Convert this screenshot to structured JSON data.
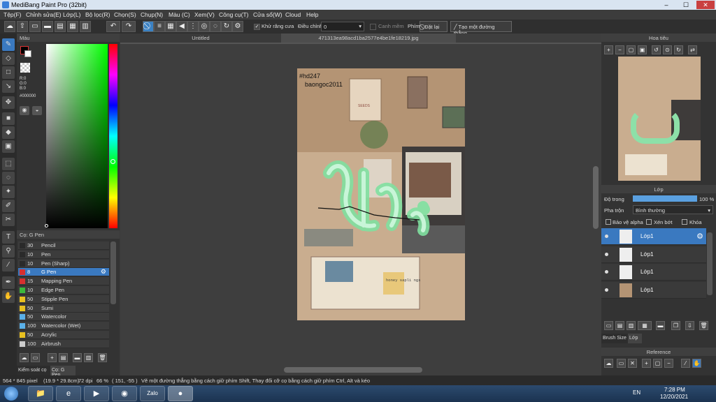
{
  "window": {
    "title": "MediBang Paint Pro (32bit)",
    "min": "–",
    "max": "☐",
    "close": "✕"
  },
  "menu": [
    "Tệp(F)",
    "Chỉnh sửa(E)",
    "Lớp(L)",
    "Bộ lọc(R)",
    "Chọn(S)",
    "Chụp(N)",
    "Màu (C)",
    "Xem(V)",
    "Công cụ(T)",
    "Cửa sổ(W)",
    "Cloud",
    "Help"
  ],
  "toolbar": {
    "antialias_label": "Khử răng cưa",
    "adjust_label": "Điều chỉnh",
    "adjust_value": "0",
    "snap_label": "Canh mềm",
    "key_label": "Phím",
    "reset_label": "Đặt lại",
    "straight_label": "Tạo một đường thẳng"
  },
  "color_panel": {
    "title": "Màu",
    "r": "R:0",
    "g": "G:0",
    "b": "B:0",
    "hex": "#000000"
  },
  "brush_panel": {
    "title": "Cọ: G Pen",
    "brushes": [
      {
        "size": "30",
        "name": "Pencil",
        "color": "#2a2a2a"
      },
      {
        "size": "10",
        "name": "Pen",
        "color": "#2a2a2a"
      },
      {
        "size": "10",
        "name": "Pen (Sharp)",
        "color": "#2a2a2a"
      },
      {
        "size": "8",
        "name": "G Pen",
        "color": "#d83030",
        "selected": true
      },
      {
        "size": "15",
        "name": "Mapping Pen",
        "color": "#d83030"
      },
      {
        "size": "10",
        "name": "Edge Pen",
        "color": "#3cb83c"
      },
      {
        "size": "50",
        "name": "Stipple Pen",
        "color": "#e8c020"
      },
      {
        "size": "50",
        "name": "Sumi",
        "color": "#e8c020"
      },
      {
        "size": "50",
        "name": "Watercolor",
        "color": "#5ab0e8"
      },
      {
        "size": "100",
        "name": "Watercolor (Wet)",
        "color": "#5ab0e8"
      },
      {
        "size": "50",
        "name": "Acrylic",
        "color": "#e8c020"
      },
      {
        "size": "100",
        "name": "Airbrush",
        "color": "#cccccc"
      }
    ],
    "tab1": "Kiểm soát cọ",
    "tab2": "Cọ: G Pen"
  },
  "canvas": {
    "tab_untitled": "Untitled",
    "tab_file": "471313ea98acd1ba2577e4be1fe18219.jpg",
    "watermark1": "#hd247",
    "watermark2": "baongoc2011",
    "notebook_text": "honey sapli ngs",
    "poster_text": "SEEDS"
  },
  "navigator": {
    "title": "Hoa tiêu"
  },
  "layer_panel": {
    "title": "Lớp",
    "opacity_label": "Độ trong",
    "opacity_value": "100 %",
    "opacity_pct": 100,
    "blend_label": "Pha trộn",
    "blend_value": "Bình thường",
    "protect_alpha": "Bảo vệ alpha",
    "clip": "Xén bớt",
    "lock": "Khóa",
    "layers": [
      {
        "name": "Lớp1",
        "selected": true
      },
      {
        "name": "Lớp1"
      },
      {
        "name": "Lớp1"
      },
      {
        "name": "Lớp1"
      }
    ],
    "tab_brush_size": "Brush Size",
    "tab_layer": "Lớp"
  },
  "reference": {
    "title": "Reference"
  },
  "status": {
    "size": "564 * 845 pixel",
    "cm": "(19.9 * 29.8cm)",
    "dpi": "72 dpi",
    "zoom": "66 %",
    "coords": "( 151, -55 )",
    "hint": "Vẽ một đường thẳng bằng cách giữ phím Shift, Thay đổi cỡ cọ bằng cách giữ phím Ctrl, Alt và kéo"
  },
  "taskbar": {
    "lang": "EN",
    "time": "7:28 PM",
    "date": "12/20/2021",
    "zalo": "Zalo"
  }
}
